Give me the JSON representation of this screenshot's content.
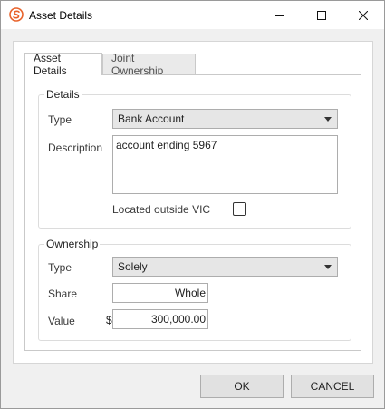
{
  "window": {
    "title": "Asset Details",
    "app_icon": "s-logo-icon",
    "controls": [
      "minimize-icon",
      "maximize-icon",
      "close-icon"
    ]
  },
  "tabs": [
    {
      "label": "Asset Details",
      "active": true
    },
    {
      "label": "Joint Ownership",
      "active": false
    }
  ],
  "details": {
    "legend": "Details",
    "type_label": "Type",
    "type_value": "Bank Account",
    "description_label": "Description",
    "description_value": "account ending 5967",
    "outside_label": "Located outside VIC",
    "outside_checked": false
  },
  "ownership": {
    "legend": "Ownership",
    "type_label": "Type",
    "type_value": "Solely",
    "share_label": "Share",
    "share_value": "Whole",
    "value_label": "Value",
    "currency_symbol": "$",
    "value_value": "300,000.00"
  },
  "buttons": {
    "ok": "OK",
    "cancel": "CANCEL"
  },
  "colors": {
    "accent": "#e8622a"
  }
}
